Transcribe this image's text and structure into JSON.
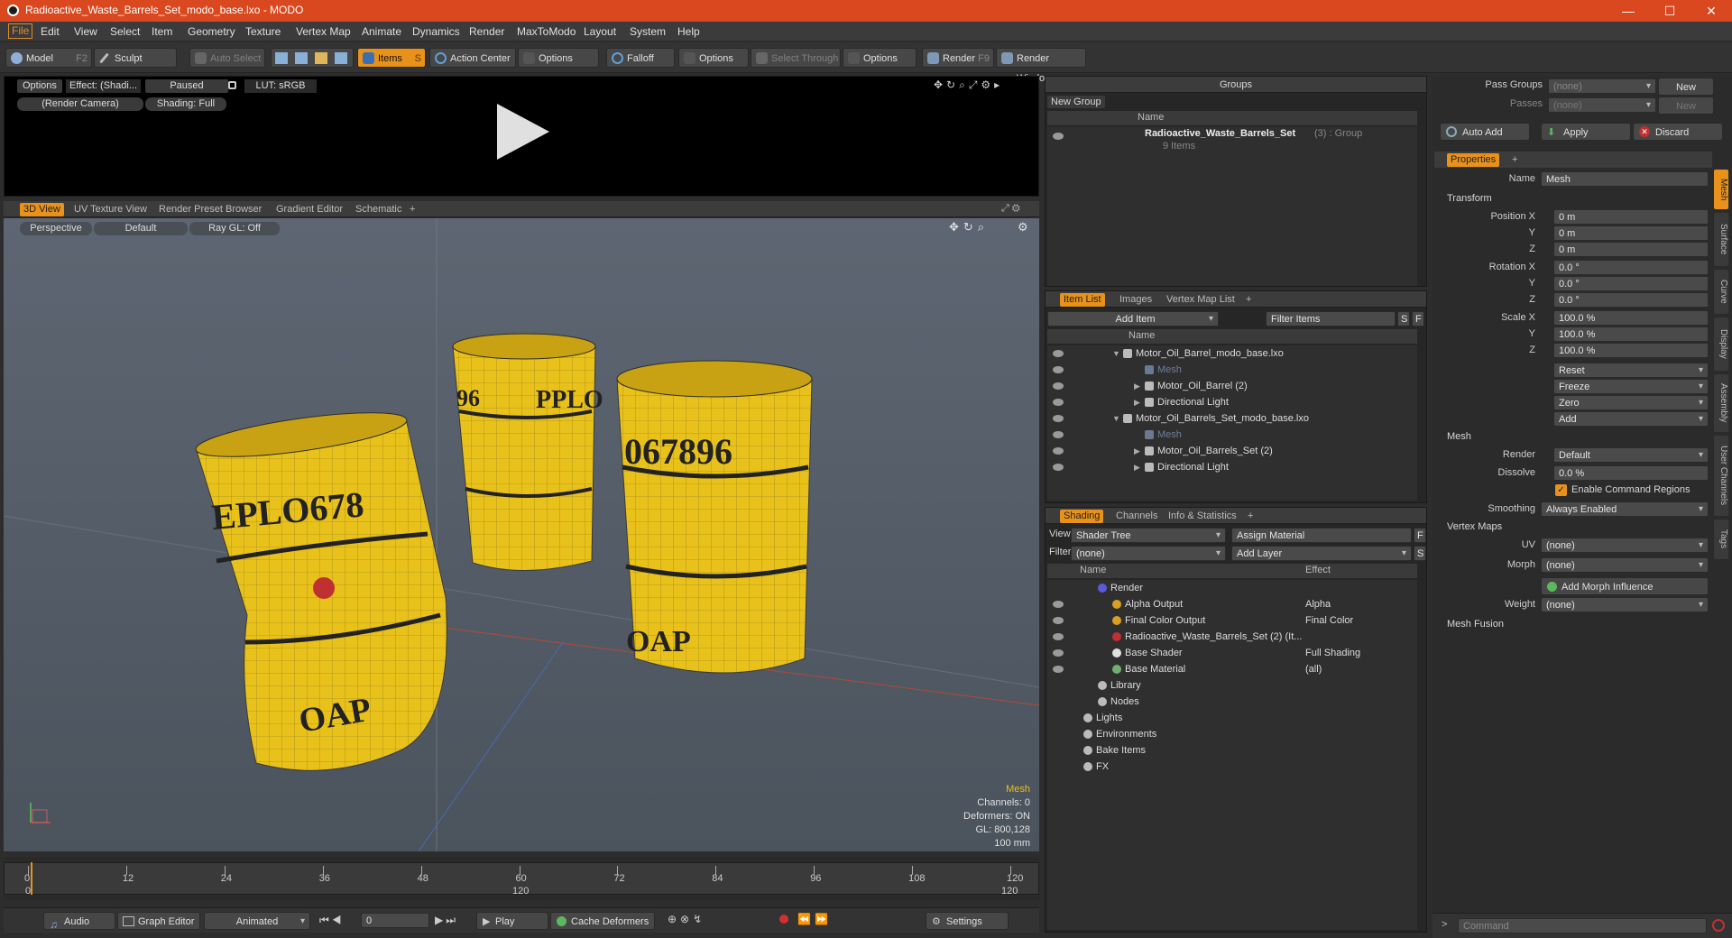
{
  "window": {
    "title": "Radioactive_Waste_Barrels_Set_modo_base.lxo - MODO",
    "minimize": "—",
    "maximize": "☐",
    "close": "✕"
  },
  "menu": [
    "File",
    "Edit",
    "View",
    "Select",
    "Item",
    "Geometry",
    "Texture",
    "Vertex Map",
    "Animate",
    "Dynamics",
    "Render",
    "MaxToModo",
    "Layout",
    "System",
    "Help"
  ],
  "toolbar": {
    "model": "Model",
    "model_key": "F2",
    "sculpt": "Sculpt",
    "auto_select": "Auto Select",
    "items": "Items",
    "items_key": "S",
    "action_center": "Action Center",
    "options1": "Options",
    "falloff": "Falloff",
    "options2": "Options",
    "select_through": "Select Through",
    "options3": "Options",
    "render": "Render",
    "render_key": "F9",
    "render_window": "Render Window"
  },
  "preview": {
    "options": "Options",
    "effect": "Effect: (Shadi...",
    "paused": "Paused",
    "lut": "LUT: sRGB",
    "camera": "(Render Camera)",
    "shading": "Shading: Full"
  },
  "viewport_tabs": [
    "3D View",
    "UV Texture View",
    "Render Preset Browser",
    "Gradient Editor",
    "Schematic",
    "+"
  ],
  "viewport": {
    "perspective": "Perspective",
    "default": "Default",
    "raygl": "Ray GL: Off",
    "barrel_labels": [
      "EPLO678",
      "OAP",
      "PPLO",
      "96",
      "067896",
      "OAP"
    ],
    "info": {
      "mesh": "Mesh",
      "channels": "Channels: 0",
      "deformers": "Deformers: ON",
      "gl": "GL: 800,128",
      "scale": "100 mm"
    }
  },
  "timeline": {
    "ticks": [
      "0",
      "12",
      "24",
      "36",
      "48",
      "60",
      "72",
      "84",
      "96",
      "108",
      "120"
    ],
    "start": "0",
    "mid": "120",
    "end": "120"
  },
  "bottom_bar": {
    "audio": "Audio",
    "graph_editor": "Graph Editor",
    "animated": "Animated",
    "frame": "0",
    "play": "Play",
    "cache": "Cache Deformers",
    "settings": "Settings"
  },
  "groups": {
    "title": "Groups",
    "new_group": "New Group",
    "col_name": "Name",
    "group_name": "Radioactive_Waste_Barrels_Set",
    "group_suffix": "(3) : Group",
    "group_items": "9 Items"
  },
  "item_list": {
    "tabs": [
      "Item List",
      "Images",
      "Vertex Map List",
      "+"
    ],
    "add_item": "Add Item",
    "filter": "Filter Items",
    "s": "S",
    "f": "F",
    "col_name": "Name",
    "rows": [
      {
        "text": "Motor_Oil_Barrel_modo_base.lxo",
        "indent": 0,
        "dim": false
      },
      {
        "text": "Mesh",
        "indent": 2,
        "dim": true
      },
      {
        "text": "Motor_Oil_Barrel (2)",
        "indent": 2,
        "dim": false
      },
      {
        "text": "Directional Light",
        "indent": 2,
        "dim": false
      },
      {
        "text": "Motor_Oil_Barrels_Set_modo_base.lxo",
        "indent": 0,
        "dim": false
      },
      {
        "text": "Mesh",
        "indent": 2,
        "dim": true
      },
      {
        "text": "Motor_Oil_Barrels_Set (2)",
        "indent": 2,
        "dim": false
      },
      {
        "text": "Directional Light",
        "indent": 2,
        "dim": false
      }
    ]
  },
  "shading": {
    "tabs": [
      "Shading",
      "Channels",
      "Info & Statistics",
      "+"
    ],
    "view_label": "View",
    "view_value": "Shader Tree",
    "assign": "Assign Material",
    "filter_label": "Filter",
    "filter_value": "(none)",
    "add_layer": "Add Layer",
    "f": "F",
    "s": "S",
    "col_name": "Name",
    "col_effect": "Effect",
    "rows": [
      {
        "name": "Render",
        "effect": "",
        "indent": 1
      },
      {
        "name": "Alpha Output",
        "effect": "Alpha",
        "indent": 2
      },
      {
        "name": "Final Color Output",
        "effect": "Final Color",
        "indent": 2
      },
      {
        "name": "Radioactive_Waste_Barrels_Set (2) (It...",
        "effect": "",
        "indent": 2
      },
      {
        "name": "Base Shader",
        "effect": "Full Shading",
        "indent": 2
      },
      {
        "name": "Base Material",
        "effect": "(all)",
        "indent": 2
      },
      {
        "name": "Library",
        "effect": "",
        "indent": 1
      },
      {
        "name": "Nodes",
        "effect": "",
        "indent": 1
      },
      {
        "name": "Lights",
        "effect": "",
        "indent": 0
      },
      {
        "name": "Environments",
        "effect": "",
        "indent": 0
      },
      {
        "name": "Bake Items",
        "effect": "",
        "indent": 0
      },
      {
        "name": "FX",
        "effect": "",
        "indent": 0
      }
    ]
  },
  "right": {
    "pass_groups": "Pass Groups",
    "pass_groups_val": "(none)",
    "new": "New",
    "passes": "Passes",
    "passes_val": "(none)",
    "new2": "New",
    "auto_add": "Auto Add",
    "apply": "Apply",
    "discard": "Discard",
    "properties_tab": "Properties",
    "plus": "+",
    "name_label": "Name",
    "name_value": "Mesh",
    "transform": "Transform",
    "position_x": "Position X",
    "rotation_x": "Rotation X",
    "scale_x": "Scale X",
    "y": "Y",
    "z": "Z",
    "pos": [
      "0 m",
      "0 m",
      "0 m"
    ],
    "rot": [
      "0.0 °",
      "0.0 °",
      "0.0 °"
    ],
    "scale": [
      "100.0 %",
      "100.0 %",
      "100.0 %"
    ],
    "reset": "Reset",
    "freeze": "Freeze",
    "zero": "Zero",
    "add": "Add",
    "mesh_section": "Mesh",
    "render_label": "Render",
    "render_value": "Default",
    "dissolve_label": "Dissolve",
    "dissolve_value": "0.0 %",
    "enable_cmd": "Enable Command Regions",
    "smoothing_label": "Smoothing",
    "smoothing_value": "Always Enabled",
    "vertex_maps": "Vertex Maps",
    "uv_label": "UV",
    "uv_value": "(none)",
    "morph_label": "Morph",
    "morph_value": "(none)",
    "add_morph": "Add Morph Influence",
    "weight_label": "Weight",
    "weight_value": "(none)",
    "mesh_fusion": "Mesh Fusion",
    "side_tabs": [
      "Mesh",
      "Surface",
      "Curve",
      "Display",
      "Assembly",
      "User Channels",
      "Tags"
    ],
    "command": "Command"
  },
  "colors": {
    "accent": "#e8921c",
    "titlebar": "#d9481f",
    "barrel": "#e9c11b"
  }
}
